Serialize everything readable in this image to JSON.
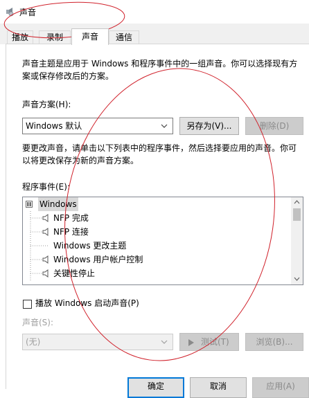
{
  "window": {
    "title": "声音"
  },
  "tabs": [
    {
      "label": "播放"
    },
    {
      "label": "录制"
    },
    {
      "label": "声音"
    },
    {
      "label": "通信"
    }
  ],
  "sounds": {
    "intro": [
      "声音主题是应用于 Windows 和程序事件中的一组声音。你可以选择现有方",
      "案或保存修改后的方案。"
    ],
    "scheme_label": "声音方案(H):",
    "scheme_value": "Windows 默认",
    "save_as_label": "另存为(V)...",
    "delete_label": "删除(D)",
    "instructions": [
      "要更改声音，请单击以下列表中的程序事件，然后选择要应用的声音。你可",
      "以将更改保存为新的声音方案。"
    ],
    "events_label": "程序事件(E):",
    "events": [
      {
        "label": "Windows"
      },
      {
        "label": "NFP 完成"
      },
      {
        "label": "NFP 连接"
      },
      {
        "label": "Windows 更改主题"
      },
      {
        "label": "Windows 用户帐户控制"
      },
      {
        "label": "关键性停止"
      }
    ],
    "startup_checkbox_label": "播放 Windows 启动声音(P)",
    "sound_label": "声音(S):",
    "sound_value": "(无)",
    "test_label": "测试(T)",
    "browse_label": "浏览(B)..."
  },
  "footer": {
    "ok_label": "确定",
    "cancel_label": "取消",
    "apply_label": "应用(A)"
  },
  "colors": {
    "accent": "#0078d7",
    "annotation": "#d0202a"
  }
}
